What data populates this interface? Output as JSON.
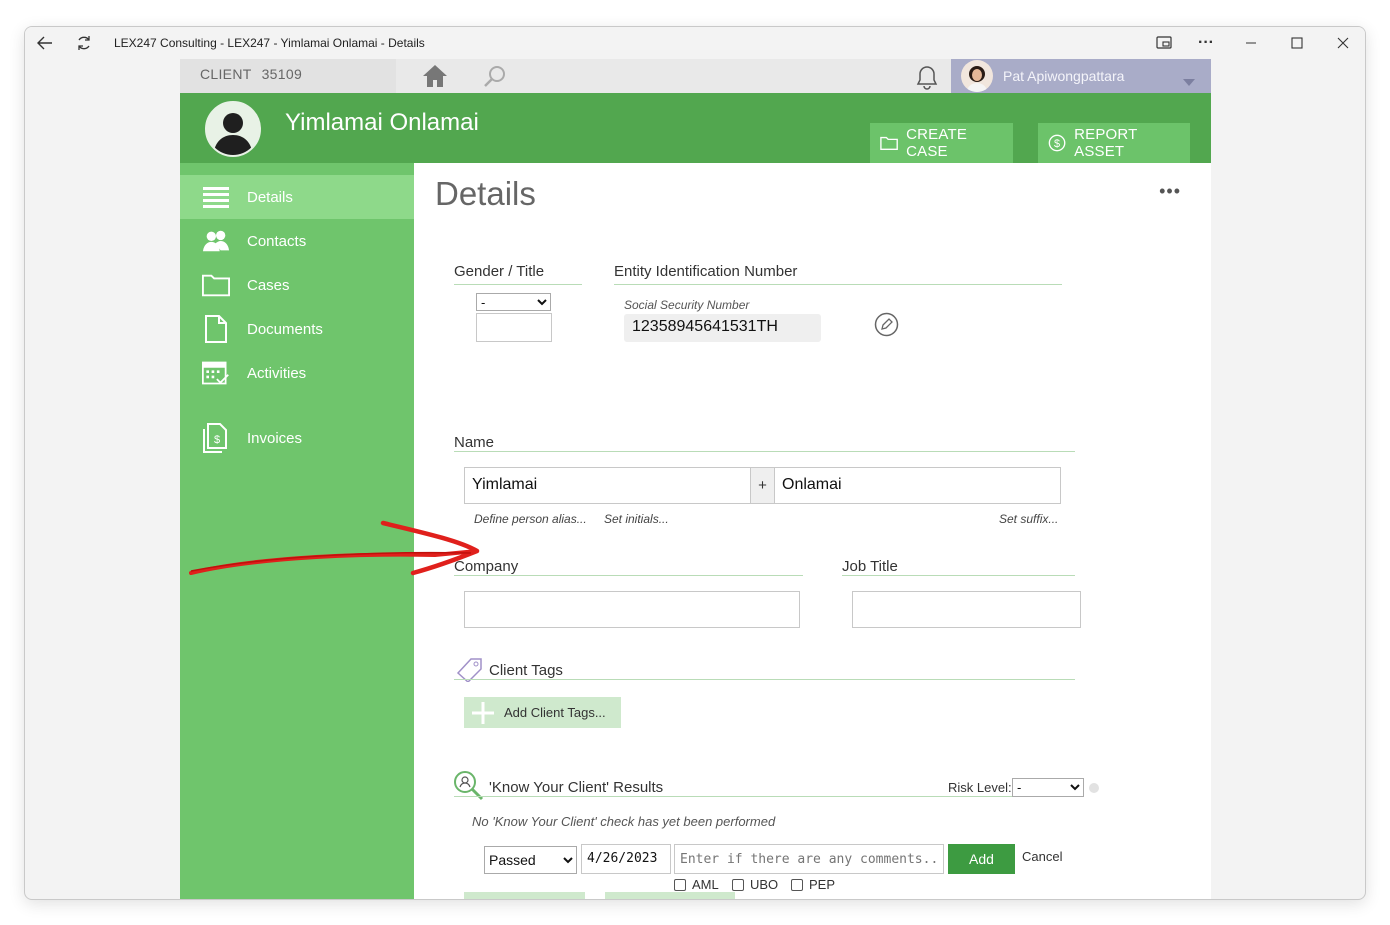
{
  "window": {
    "title": "LEX247 Consulting - LEX247 - Yimlamai Onlamai - Details"
  },
  "topbar": {
    "client_label": "CLIENT",
    "client_number": "35109",
    "user_name": "Pat Apiwongpattara"
  },
  "header": {
    "client_name": "Yimlamai Onlamai",
    "create_case_label": "CREATE CASE",
    "report_asset_label": "REPORT ASSET"
  },
  "sidebar": {
    "items": [
      {
        "label": "Details",
        "icon": "list-icon",
        "active": true
      },
      {
        "label": "Contacts",
        "icon": "people-icon",
        "active": false
      },
      {
        "label": "Cases",
        "icon": "folder-icon",
        "active": false
      },
      {
        "label": "Documents",
        "icon": "document-icon",
        "active": false
      },
      {
        "label": "Activities",
        "icon": "calendar-icon",
        "active": false
      },
      {
        "label": "Invoices",
        "icon": "invoice-icon",
        "active": false
      }
    ]
  },
  "main": {
    "title": "Details",
    "gender_title_label": "Gender / Title",
    "gender_select_value": "-",
    "entity_id_label": "Entity Identification Number",
    "ssn_label": "Social Security Number",
    "ssn_value": "12358945641531TH",
    "name_label": "Name",
    "first_name": "Yimlamai",
    "name_separator": "+",
    "last_name": "Onlamai",
    "define_alias": "Define person alias...",
    "set_initials": "Set initials...",
    "set_suffix": "Set suffix...",
    "company_label": "Company",
    "company_value": "",
    "job_title_label": "Job Title",
    "job_title_value": "",
    "client_tags_label": "Client Tags",
    "add_client_tags_label": "Add Client Tags...",
    "kyc_label": "'Know Your Client' Results",
    "risk_level_label": "Risk Level:",
    "risk_level_value": "-",
    "kyc_empty_text": "No 'Know Your Client' check has yet been performed",
    "kyc_status_value": "Passed",
    "kyc_date_value": "4/26/2023",
    "kyc_comment_placeholder": "Enter if there are any comments...",
    "add_label": "Add",
    "cancel_label": "Cancel",
    "check_aml": "AML",
    "check_ubo": "UBO",
    "check_pep": "PEP"
  },
  "colors": {
    "header_green": "#52a74f",
    "sidebar_green": "#6fc56c",
    "active_nav": "#8ed98a",
    "button_green": "#3d9b41",
    "annotation_red": "#e0201c"
  }
}
